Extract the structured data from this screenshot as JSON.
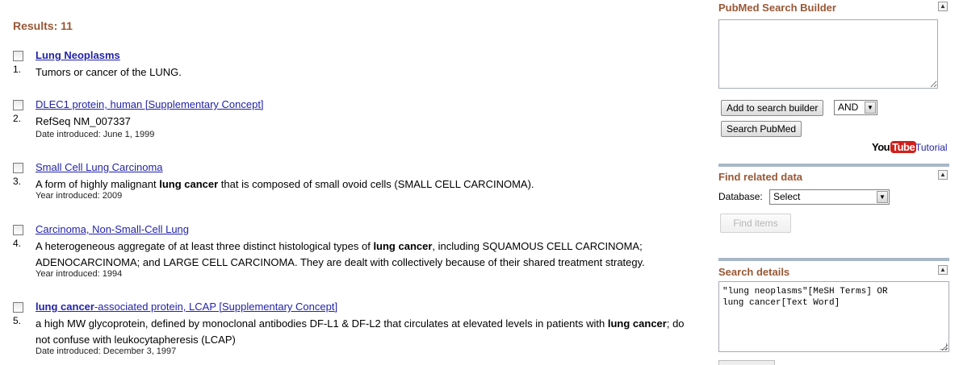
{
  "results_header": "Results: 11",
  "results": [
    {
      "number": "1.",
      "title": "Lung Neoplasms",
      "title_bold": true,
      "description": "Tumors or cancer of the LUNG.",
      "date": ""
    },
    {
      "number": "2.",
      "title": "DLEC1 protein, human [Supplementary Concept]",
      "title_bold": false,
      "description": "RefSeq NM_007337",
      "date": "Date introduced: June 1, 1999"
    },
    {
      "number": "3.",
      "title": "Small Cell Lung Carcinoma",
      "title_bold": false,
      "description_parts": [
        "A form of highly malignant ",
        "lung cancer",
        " that is composed of small ovoid cells (SMALL CELL CARCINOMA)."
      ],
      "date": "Year introduced: 2009"
    },
    {
      "number": "4.",
      "title": "Carcinoma, Non-Small-Cell Lung",
      "title_bold": false,
      "description_parts": [
        "A heterogeneous aggregate of at least three distinct histological types of ",
        "lung cancer",
        ", including SQUAMOUS CELL CARCINOMA; ADENOCARCINOMA; and LARGE CELL CARCINOMA. They are dealt with collectively because of their shared treatment strategy."
      ],
      "date": "Year introduced: 1994"
    },
    {
      "number": "5.",
      "title_bold_part": "lung cancer",
      "title_rest": "-associated protein, LCAP [Supplementary Concept]",
      "description_parts": [
        "a high MW glycoprotein, defined by monoclonal antibodies DF-L1 & DF-L2 that circulates at elevated levels in patients with ",
        "lung cancer",
        "; do not confuse with leukocytapheresis (LCAP)"
      ],
      "date": "Date introduced: December 3, 1997"
    }
  ],
  "sidebar": {
    "builder_title": "PubMed Search Builder",
    "builder_text": "",
    "add_button": "Add to search builder",
    "operator": "AND",
    "search_button": "Search PubMed",
    "yt_you": "You",
    "yt_tube": "Tube",
    "tutorial": "Tutorial",
    "related_title": "Find related data",
    "database_label": "Database:",
    "database_value": "Select",
    "find_items": "Find items",
    "details_title": "Search details",
    "details_text": "\"lung neoplasms\"[MeSH Terms] OR\nlung cancer[Text Word]",
    "collapse_glyph": "▲",
    "dropdown_glyph": "▼"
  }
}
